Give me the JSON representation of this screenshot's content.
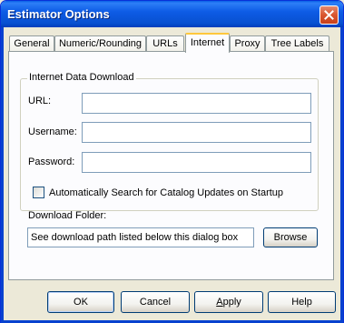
{
  "window": {
    "title": "Estimator Options"
  },
  "tabs": [
    "General",
    "Numeric/Rounding",
    "URLs",
    "Internet",
    "Proxy",
    "Tree Labels"
  ],
  "active_tab": "Internet",
  "group": {
    "label": "Internet Data Download",
    "url_label": "URL:",
    "url_value": "",
    "username_label": "Username:",
    "username_value": "",
    "password_label": "Password:",
    "password_value": "",
    "auto_search_label": "Automatically Search for Catalog Updates on Startup",
    "auto_search_checked": false,
    "download_folder_label": "Download Folder:",
    "download_folder_value": "See download path listed below this dialog box",
    "browse_label": "Browse"
  },
  "buttons": {
    "ok": "OK",
    "cancel": "Cancel",
    "apply_first": "A",
    "apply_rest": "pply",
    "help": "Help"
  },
  "icons": {
    "close": "close-x-icon"
  },
  "colors": {
    "titlebar": "#0a5fe6",
    "face": "#ece9d8",
    "active_tab_accent": "#ffc83c"
  }
}
